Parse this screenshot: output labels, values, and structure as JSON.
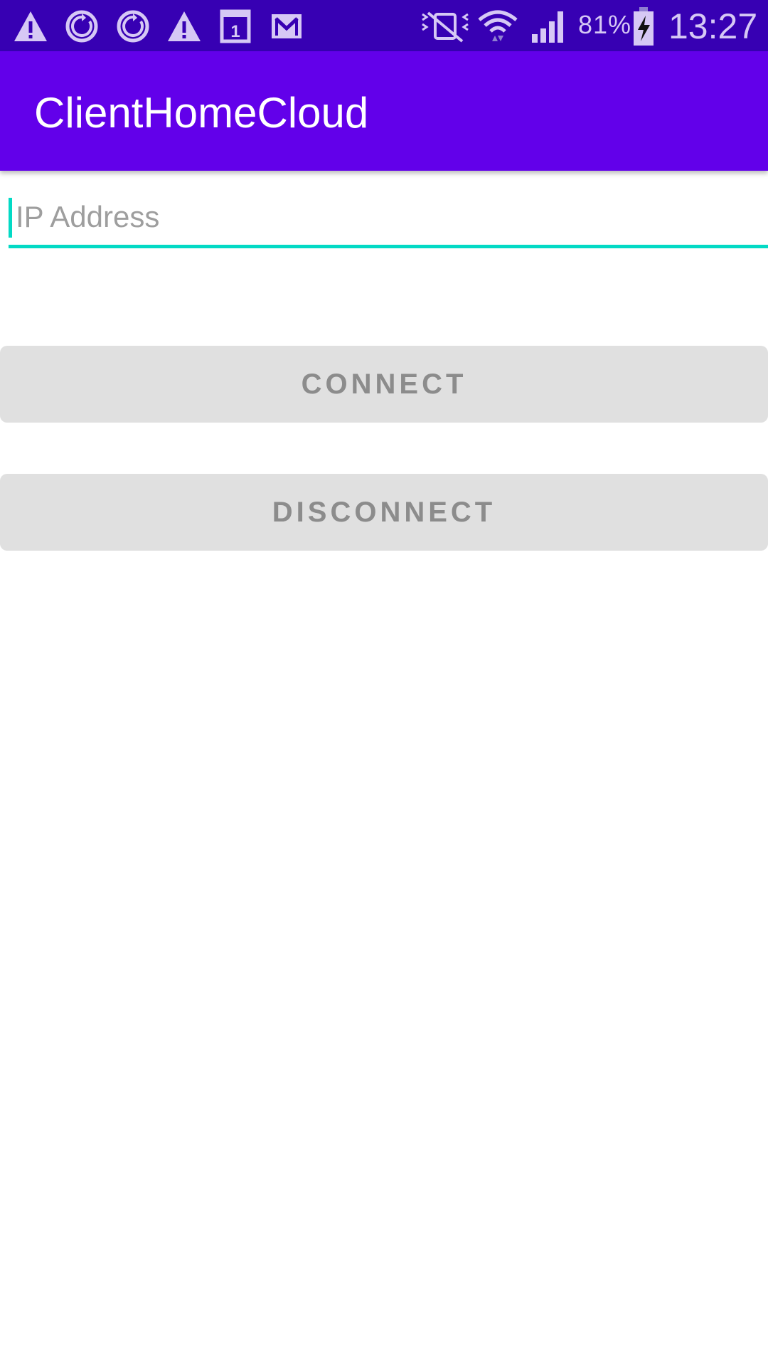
{
  "status_bar": {
    "battery_percent": "81%",
    "time": "13:27",
    "icons": [
      "warning-icon",
      "sync-icon",
      "sync-icon",
      "warning-icon",
      "calendar-icon",
      "gmail-icon",
      "vibrate-icon",
      "wifi-icon",
      "signal-icon",
      "battery-charging-icon"
    ],
    "calendar_day": "1"
  },
  "app_bar": {
    "title": "ClientHomeCloud"
  },
  "ip_field": {
    "placeholder": "IP Address",
    "value": ""
  },
  "buttons": {
    "connect_label": "CONNECT",
    "disconnect_label": "DISCONNECT"
  },
  "colors": {
    "status_bar": "#3700b3",
    "app_bar": "#6200ea",
    "accent": "#03dac5",
    "button_bg": "#e0e0e0",
    "button_text": "#8c8c8c"
  }
}
